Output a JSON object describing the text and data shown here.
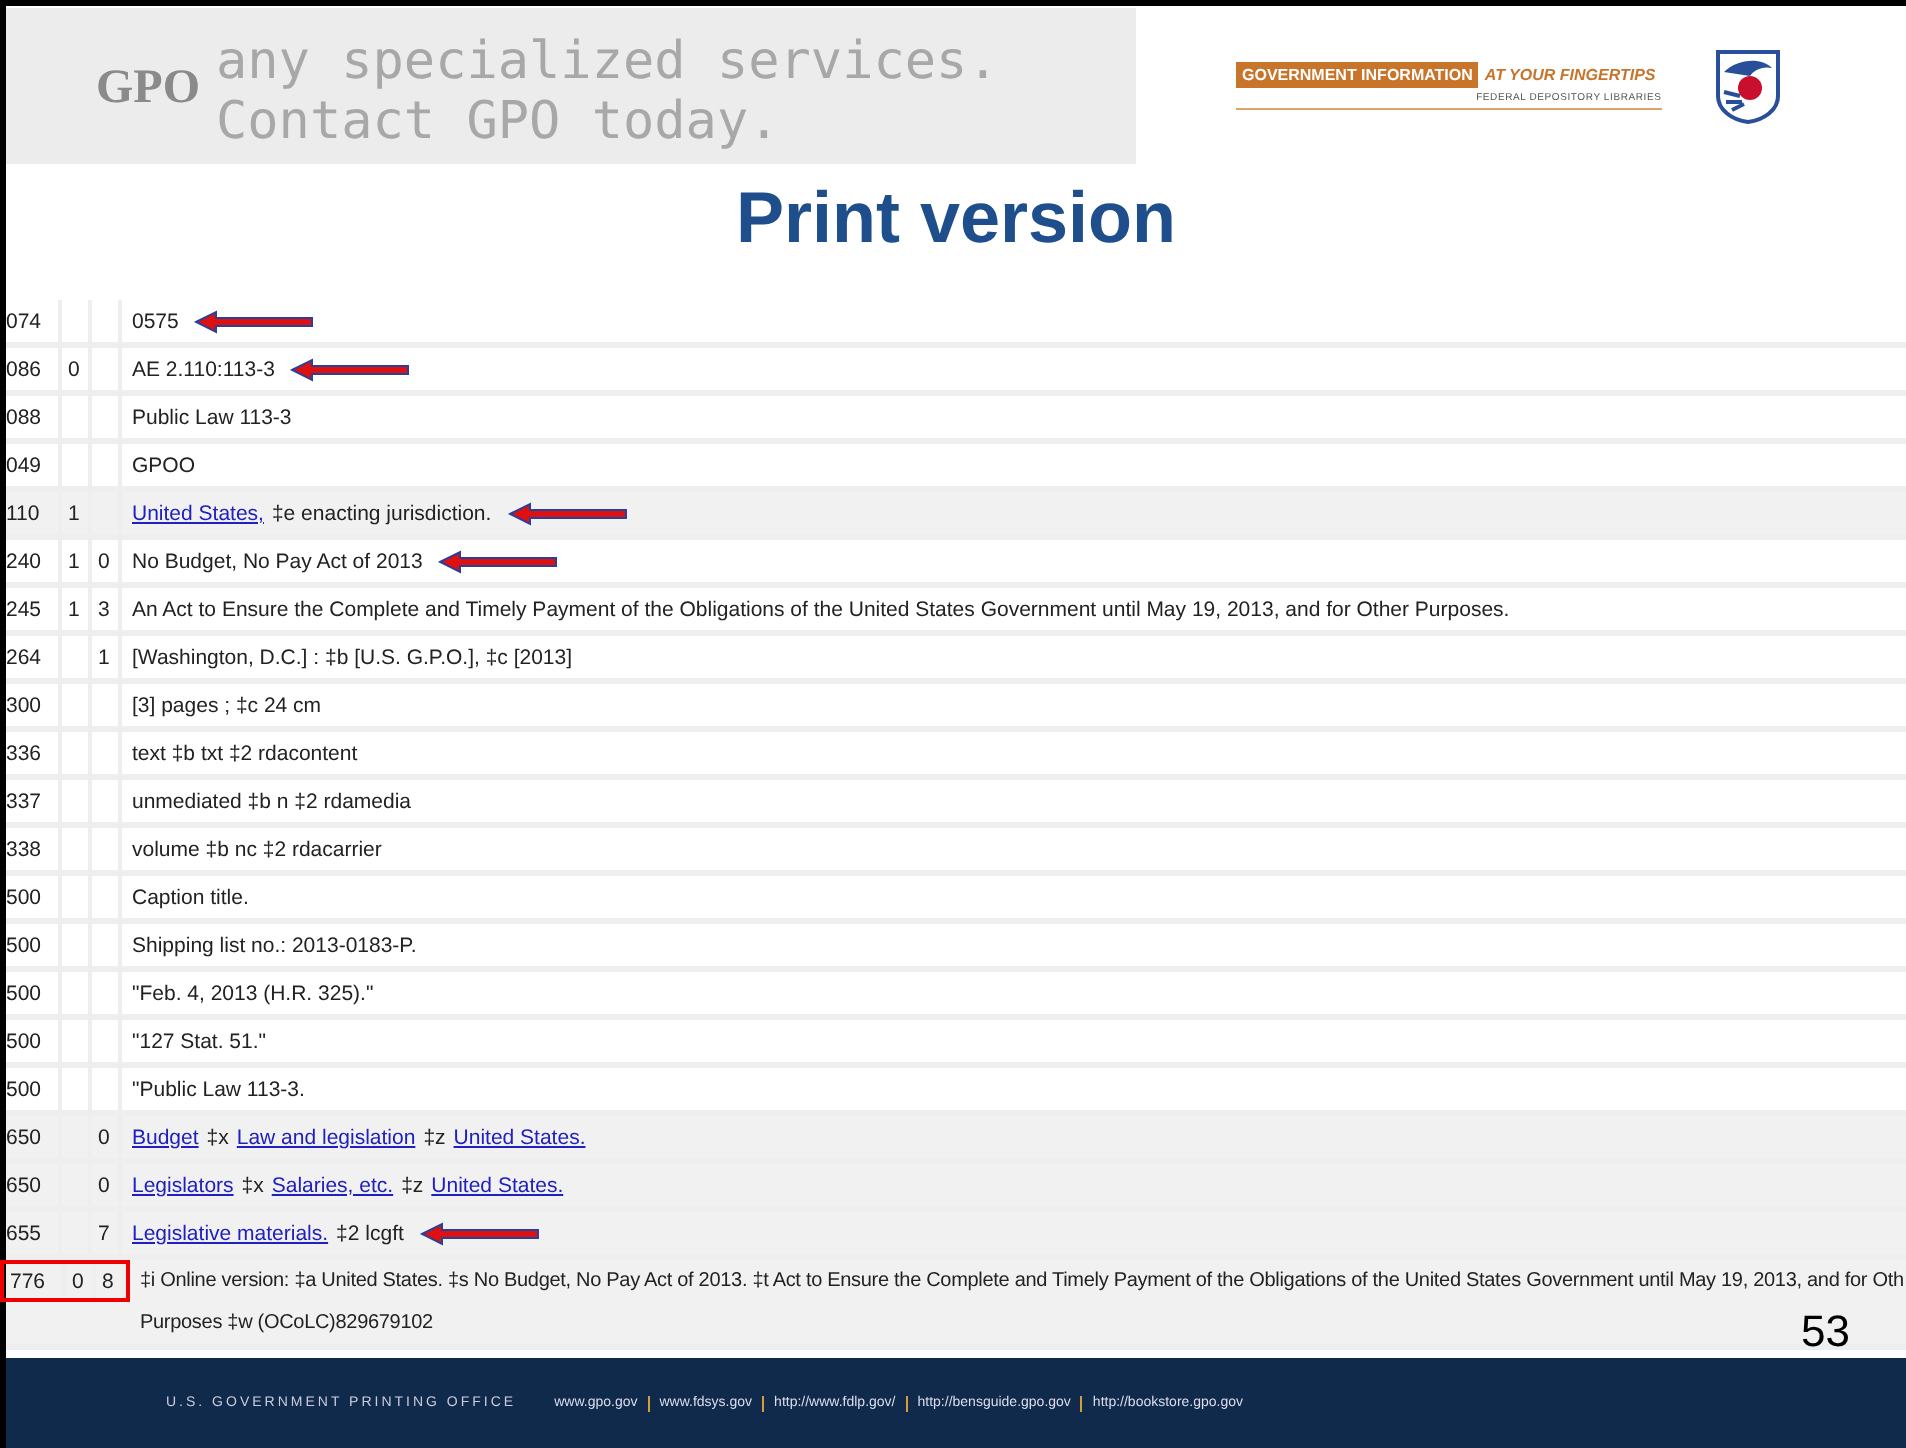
{
  "banner": {
    "background_lines": [
      "any specialized services.",
      "Contact GPO today."
    ],
    "logo": "GPO",
    "tagline": {
      "main": "GOVERNMENT INFORMATION",
      "accent": "AT YOUR FINGERTIPS",
      "sub": "FEDERAL DEPOSITORY LIBRARIES"
    }
  },
  "title": "Print version",
  "record": {
    "rows": [
      {
        "tag": "074",
        "ind1": "",
        "ind2": "",
        "shaded": false,
        "arrow": true,
        "boxed": false,
        "lines": [
          [
            {
              "text": "0575",
              "link": false
            }
          ]
        ]
      },
      {
        "tag": "086",
        "ind1": "0",
        "ind2": "",
        "shaded": false,
        "arrow": true,
        "boxed": false,
        "lines": [
          [
            {
              "text": "AE 2.110:113-3",
              "link": false
            }
          ]
        ]
      },
      {
        "tag": "088",
        "ind1": "",
        "ind2": "",
        "shaded": false,
        "arrow": false,
        "boxed": false,
        "lines": [
          [
            {
              "text": "Public Law 113-3",
              "link": false
            }
          ]
        ]
      },
      {
        "tag": "049",
        "ind1": "",
        "ind2": "",
        "shaded": false,
        "arrow": false,
        "boxed": false,
        "lines": [
          [
            {
              "text": "GPOO",
              "link": false
            }
          ]
        ]
      },
      {
        "tag": "110",
        "ind1": "1",
        "ind2": "",
        "shaded": true,
        "arrow": true,
        "boxed": false,
        "lines": [
          [
            {
              "text": "United States,",
              "link": true
            },
            {
              "text": "‡e enacting jurisdiction.",
              "link": false
            }
          ]
        ]
      },
      {
        "tag": "240",
        "ind1": "1",
        "ind2": "0",
        "shaded": false,
        "arrow": true,
        "boxed": false,
        "lines": [
          [
            {
              "text": "No Budget, No Pay Act of 2013",
              "link": false
            }
          ]
        ]
      },
      {
        "tag": "245",
        "ind1": "1",
        "ind2": "3",
        "shaded": false,
        "arrow": false,
        "boxed": false,
        "lines": [
          [
            {
              "text": "An Act to Ensure the Complete and Timely Payment of the Obligations of the United States Government until May 19, 2013, and for Other Purposes.",
              "link": false
            }
          ]
        ]
      },
      {
        "tag": "264",
        "ind1": "",
        "ind2": "1",
        "shaded": false,
        "arrow": false,
        "boxed": false,
        "lines": [
          [
            {
              "text": "[Washington, D.C.] : ‡b [U.S. G.P.O.], ‡c [2013]",
              "link": false
            }
          ]
        ]
      },
      {
        "tag": "300",
        "ind1": "",
        "ind2": "",
        "shaded": false,
        "arrow": false,
        "boxed": false,
        "lines": [
          [
            {
              "text": "[3] pages ; ‡c 24 cm",
              "link": false
            }
          ]
        ]
      },
      {
        "tag": "336",
        "ind1": "",
        "ind2": "",
        "shaded": false,
        "arrow": false,
        "boxed": false,
        "lines": [
          [
            {
              "text": "text ‡b txt ‡2 rdacontent",
              "link": false
            }
          ]
        ]
      },
      {
        "tag": "337",
        "ind1": "",
        "ind2": "",
        "shaded": false,
        "arrow": false,
        "boxed": false,
        "lines": [
          [
            {
              "text": "unmediated ‡b n ‡2 rdamedia",
              "link": false
            }
          ]
        ]
      },
      {
        "tag": "338",
        "ind1": "",
        "ind2": "",
        "shaded": false,
        "arrow": false,
        "boxed": false,
        "lines": [
          [
            {
              "text": "volume ‡b nc ‡2 rdacarrier",
              "link": false
            }
          ]
        ]
      },
      {
        "tag": "500",
        "ind1": "",
        "ind2": "",
        "shaded": false,
        "arrow": false,
        "boxed": false,
        "lines": [
          [
            {
              "text": "Caption title.",
              "link": false
            }
          ]
        ]
      },
      {
        "tag": "500",
        "ind1": "",
        "ind2": "",
        "shaded": false,
        "arrow": false,
        "boxed": false,
        "lines": [
          [
            {
              "text": "Shipping list no.: 2013-0183-P.",
              "link": false
            }
          ]
        ]
      },
      {
        "tag": "500",
        "ind1": "",
        "ind2": "",
        "shaded": false,
        "arrow": false,
        "boxed": false,
        "lines": [
          [
            {
              "text": "\"Feb. 4, 2013 (H.R. 325).\"",
              "link": false
            }
          ]
        ]
      },
      {
        "tag": "500",
        "ind1": "",
        "ind2": "",
        "shaded": false,
        "arrow": false,
        "boxed": false,
        "lines": [
          [
            {
              "text": "\"127 Stat. 51.\"",
              "link": false
            }
          ]
        ]
      },
      {
        "tag": "500",
        "ind1": "",
        "ind2": "",
        "shaded": false,
        "arrow": false,
        "boxed": false,
        "lines": [
          [
            {
              "text": "\"Public Law 113-3.",
              "link": false
            }
          ]
        ]
      },
      {
        "tag": "650",
        "ind1": "",
        "ind2": "0",
        "shaded": true,
        "arrow": false,
        "boxed": false,
        "lines": [
          [
            {
              "text": "Budget",
              "link": true
            },
            {
              "text": "‡x",
              "link": false
            },
            {
              "text": "Law and legislation",
              "link": true
            },
            {
              "text": "‡z",
              "link": false
            },
            {
              "text": "United States.",
              "link": true
            }
          ]
        ]
      },
      {
        "tag": "650",
        "ind1": "",
        "ind2": "0",
        "shaded": true,
        "arrow": false,
        "boxed": false,
        "lines": [
          [
            {
              "text": "Legislators",
              "link": true
            },
            {
              "text": "‡x",
              "link": false
            },
            {
              "text": "Salaries, etc.",
              "link": true
            },
            {
              "text": "‡z",
              "link": false
            },
            {
              "text": "United States.",
              "link": true
            }
          ]
        ]
      },
      {
        "tag": "655",
        "ind1": "",
        "ind2": "7",
        "shaded": true,
        "arrow": true,
        "boxed": false,
        "lines": [
          [
            {
              "text": "Legislative materials.",
              "link": true
            },
            {
              "text": "‡2 lcgft",
              "link": false
            }
          ]
        ]
      },
      {
        "tag": "776",
        "ind1": "0",
        "ind2": "8",
        "shaded": true,
        "arrow": false,
        "boxed": true,
        "lines": [
          [
            {
              "text": "‡i Online version: ‡a United States. ‡s No Budget, No Pay Act of 2013. ‡t Act to Ensure the Complete and Timely Payment of the Obligations of the United States Government until May 19, 2013, and for Oth",
              "link": false
            }
          ],
          [
            {
              "text": "Purposes ‡w (OCoLC)829679102",
              "link": false
            }
          ]
        ]
      }
    ]
  },
  "slide_number": "53",
  "footer": {
    "org": "U.S. GOVERNMENT PRINTING OFFICE",
    "links": [
      "www.gpo.gov",
      "www.fdsys.gov",
      "http://www.fdlp.gov/",
      "http://bensguide.gpo.gov",
      "http://bookstore.gpo.gov"
    ]
  }
}
